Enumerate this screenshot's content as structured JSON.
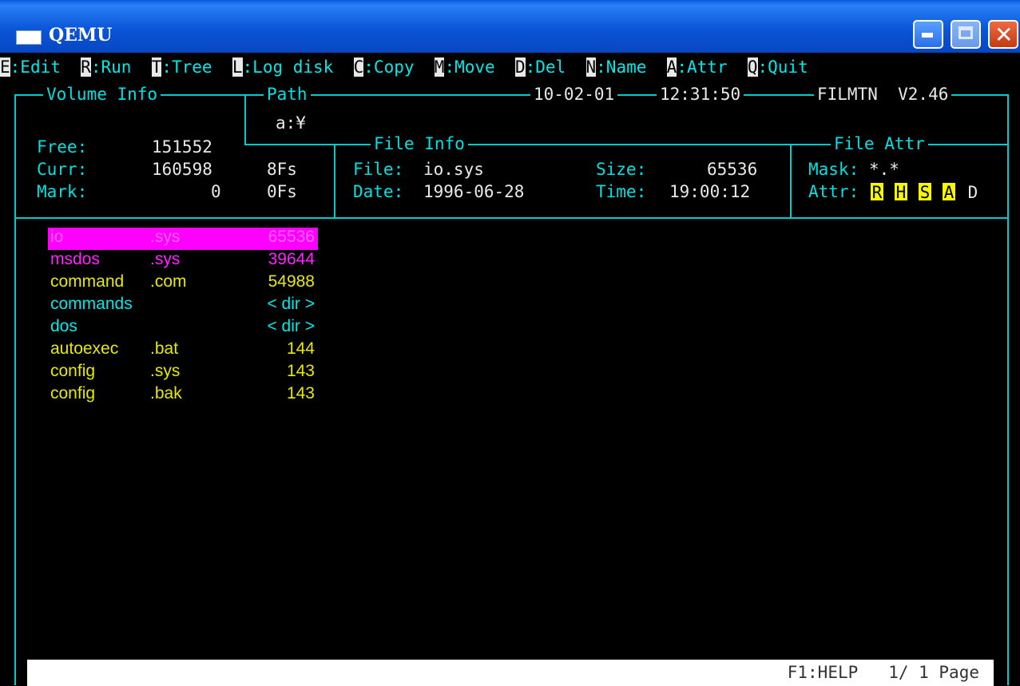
{
  "window": {
    "title": "QEMU"
  },
  "menu": [
    {
      "key": "E",
      "label": ":Edit"
    },
    {
      "key": "R",
      "label": ":Run"
    },
    {
      "key": "T",
      "label": ":Tree"
    },
    {
      "key": "L",
      "label": ":Log disk"
    },
    {
      "key": "C",
      "label": ":Copy"
    },
    {
      "key": "M",
      "label": ":Move"
    },
    {
      "key": "D",
      "label": ":Del"
    },
    {
      "key": "N",
      "label": ":Name"
    },
    {
      "key": "A",
      "label": ":Attr"
    },
    {
      "key": "Q",
      "label": ":Quit"
    }
  ],
  "header": {
    "volume_info": "Volume Info",
    "path_label": "Path",
    "path_value": "a:¥",
    "date": "10-02-01",
    "time": "12:31:50",
    "app": "FILMTN  V2.46"
  },
  "volume": {
    "free_label": "Free:",
    "free_value": "151552",
    "curr_label": "Curr:",
    "curr_value": "160598",
    "curr_files": "8Fs",
    "mark_label": "Mark:",
    "mark_value": "0",
    "mark_files": "0Fs"
  },
  "file_info": {
    "title": "File Info",
    "file_label": "File:",
    "file_value": "io.sys",
    "size_label": "Size:",
    "size_value": "65536",
    "date_label": "Date:",
    "date_value": "1996-06-28",
    "time_label": "Time:",
    "time_value": "19:00:12"
  },
  "file_attr": {
    "title": "File Attr",
    "mask_label": "Mask:",
    "mask_value": "*.*",
    "attr_label": "Attr:",
    "flags": [
      "R",
      "H",
      "S",
      "A",
      "D"
    ]
  },
  "files": [
    {
      "name": "io",
      "ext": ".sys",
      "size": "65536",
      "color": "selected"
    },
    {
      "name": "msdos",
      "ext": ".sys",
      "size": "39644",
      "color": "magenta"
    },
    {
      "name": "command",
      "ext": ".com",
      "size": "54988",
      "color": "yellow"
    },
    {
      "name": "commands",
      "ext": "",
      "size": "< dir >",
      "color": "cyan"
    },
    {
      "name": "dos",
      "ext": "",
      "size": "< dir >",
      "color": "cyan"
    },
    {
      "name": "autoexec",
      "ext": ".bat",
      "size": "144",
      "color": "yellow"
    },
    {
      "name": "config",
      "ext": ".sys",
      "size": "143",
      "color": "yellow"
    },
    {
      "name": "config",
      "ext": ".bak",
      "size": "143",
      "color": "yellow"
    }
  ],
  "status": {
    "help": "F1:HELP",
    "page": "1/ 1 Page"
  },
  "colors": {
    "frame": "#00cccc",
    "selected_bg": "#ff00ff",
    "attr_on": "#f7f700"
  }
}
